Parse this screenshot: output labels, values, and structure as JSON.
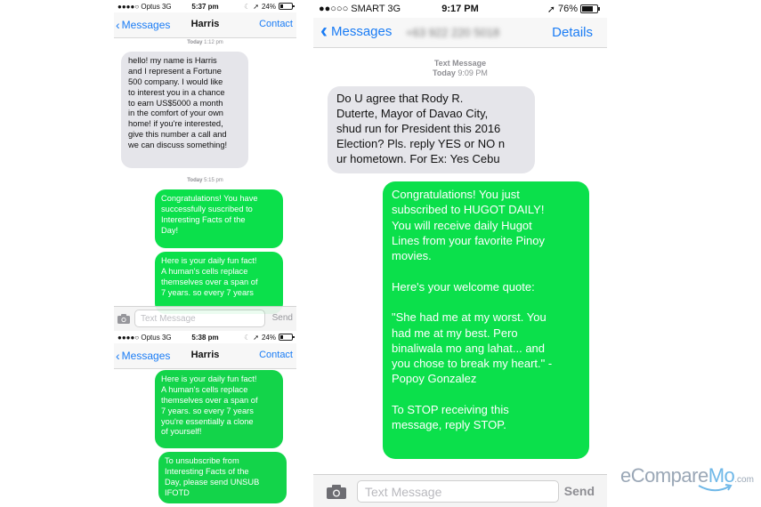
{
  "left_top": {
    "status": {
      "carrier": "●●●●○ Optus  3G",
      "time": "5:37 pm",
      "battery": "24%",
      "battery_level": 0.24
    },
    "nav": {
      "back": "Messages",
      "title": "Harris",
      "right": "Contact"
    },
    "timestamps": [
      {
        "day": "Today",
        "time": "1:12 pm"
      },
      {
        "day": "Today",
        "time": "5:15 pm"
      }
    ],
    "messages": [
      {
        "direction": "incoming",
        "text": "hello! my name is Harris\nand I represent a Fortune\n500 company. I would like\nto interest you in a chance\nto earn US$5000 a month\nin the comfort of your own\nhome! if you're interested,\ngive this number a call and\nwe can discuss something!"
      },
      {
        "direction": "outgoing",
        "text": "Congratulations! You have\nsuccessfully suscribed to\nInteresting Facts of the\nDay!"
      },
      {
        "direction": "outgoing",
        "text": "Here is your daily fun fact!\nA human's cells replace\nthemselves over a span of\n7 years. so every 7 years"
      }
    ],
    "input": {
      "placeholder": "Text Message",
      "send": "Send"
    }
  },
  "left_bottom": {
    "status": {
      "carrier": "●●●●○ Optus  3G",
      "time": "5:38 pm",
      "battery": "24%",
      "battery_level": 0.24
    },
    "nav": {
      "back": "Messages",
      "title": "Harris",
      "right": "Contact"
    },
    "messages": [
      {
        "direction": "outgoing",
        "text": "Here is your daily fun fact!\nA human's cells replace\nthemselves over a span of\n7 years. so every 7 years\nyou're essentially a clone\nof yourself!"
      },
      {
        "direction": "outgoing",
        "text": "To unsubscribe from\nInteresting Facts of the\nDay, please send UNSUB\nIFOTD"
      }
    ]
  },
  "right": {
    "status": {
      "carrier": "●●○○○ SMART  3G",
      "time": "9:17 PM",
      "battery": "76%",
      "battery_level": 0.76
    },
    "nav": {
      "back": "Messages",
      "title": "+63 922 220 5018",
      "right": "Details"
    },
    "timestamp": {
      "label": "Text Message",
      "day": "Today",
      "time": "9:09 PM"
    },
    "messages": [
      {
        "direction": "incoming",
        "text": "Do U agree that Rody R.\nDuterte, Mayor of Davao City,\nshud run for President this 2016\nElection? Pls. reply YES or NO n\nur hometown. For Ex: Yes Cebu"
      },
      {
        "direction": "outgoing",
        "text": "Congratulations! You just\nsubscribed to HUGOT DAILY!\nYou will receive daily Hugot\nLines from your favorite Pinoy\nmovies.\n\nHere's your welcome quote:\n\n\"She had me at my worst. You\nhad me at my best. Pero\nbinaliwala mo ang lahat... and\nyou chose to break my heart.\" -\nPopoy Gonzalez\n\nTo STOP receiving this\nmessage, reply STOP."
      }
    ],
    "input": {
      "placeholder": "Text Message",
      "send": "Send"
    }
  },
  "watermark": {
    "part1": "eCompare",
    "part2": "Mo",
    "part3": ".com"
  }
}
